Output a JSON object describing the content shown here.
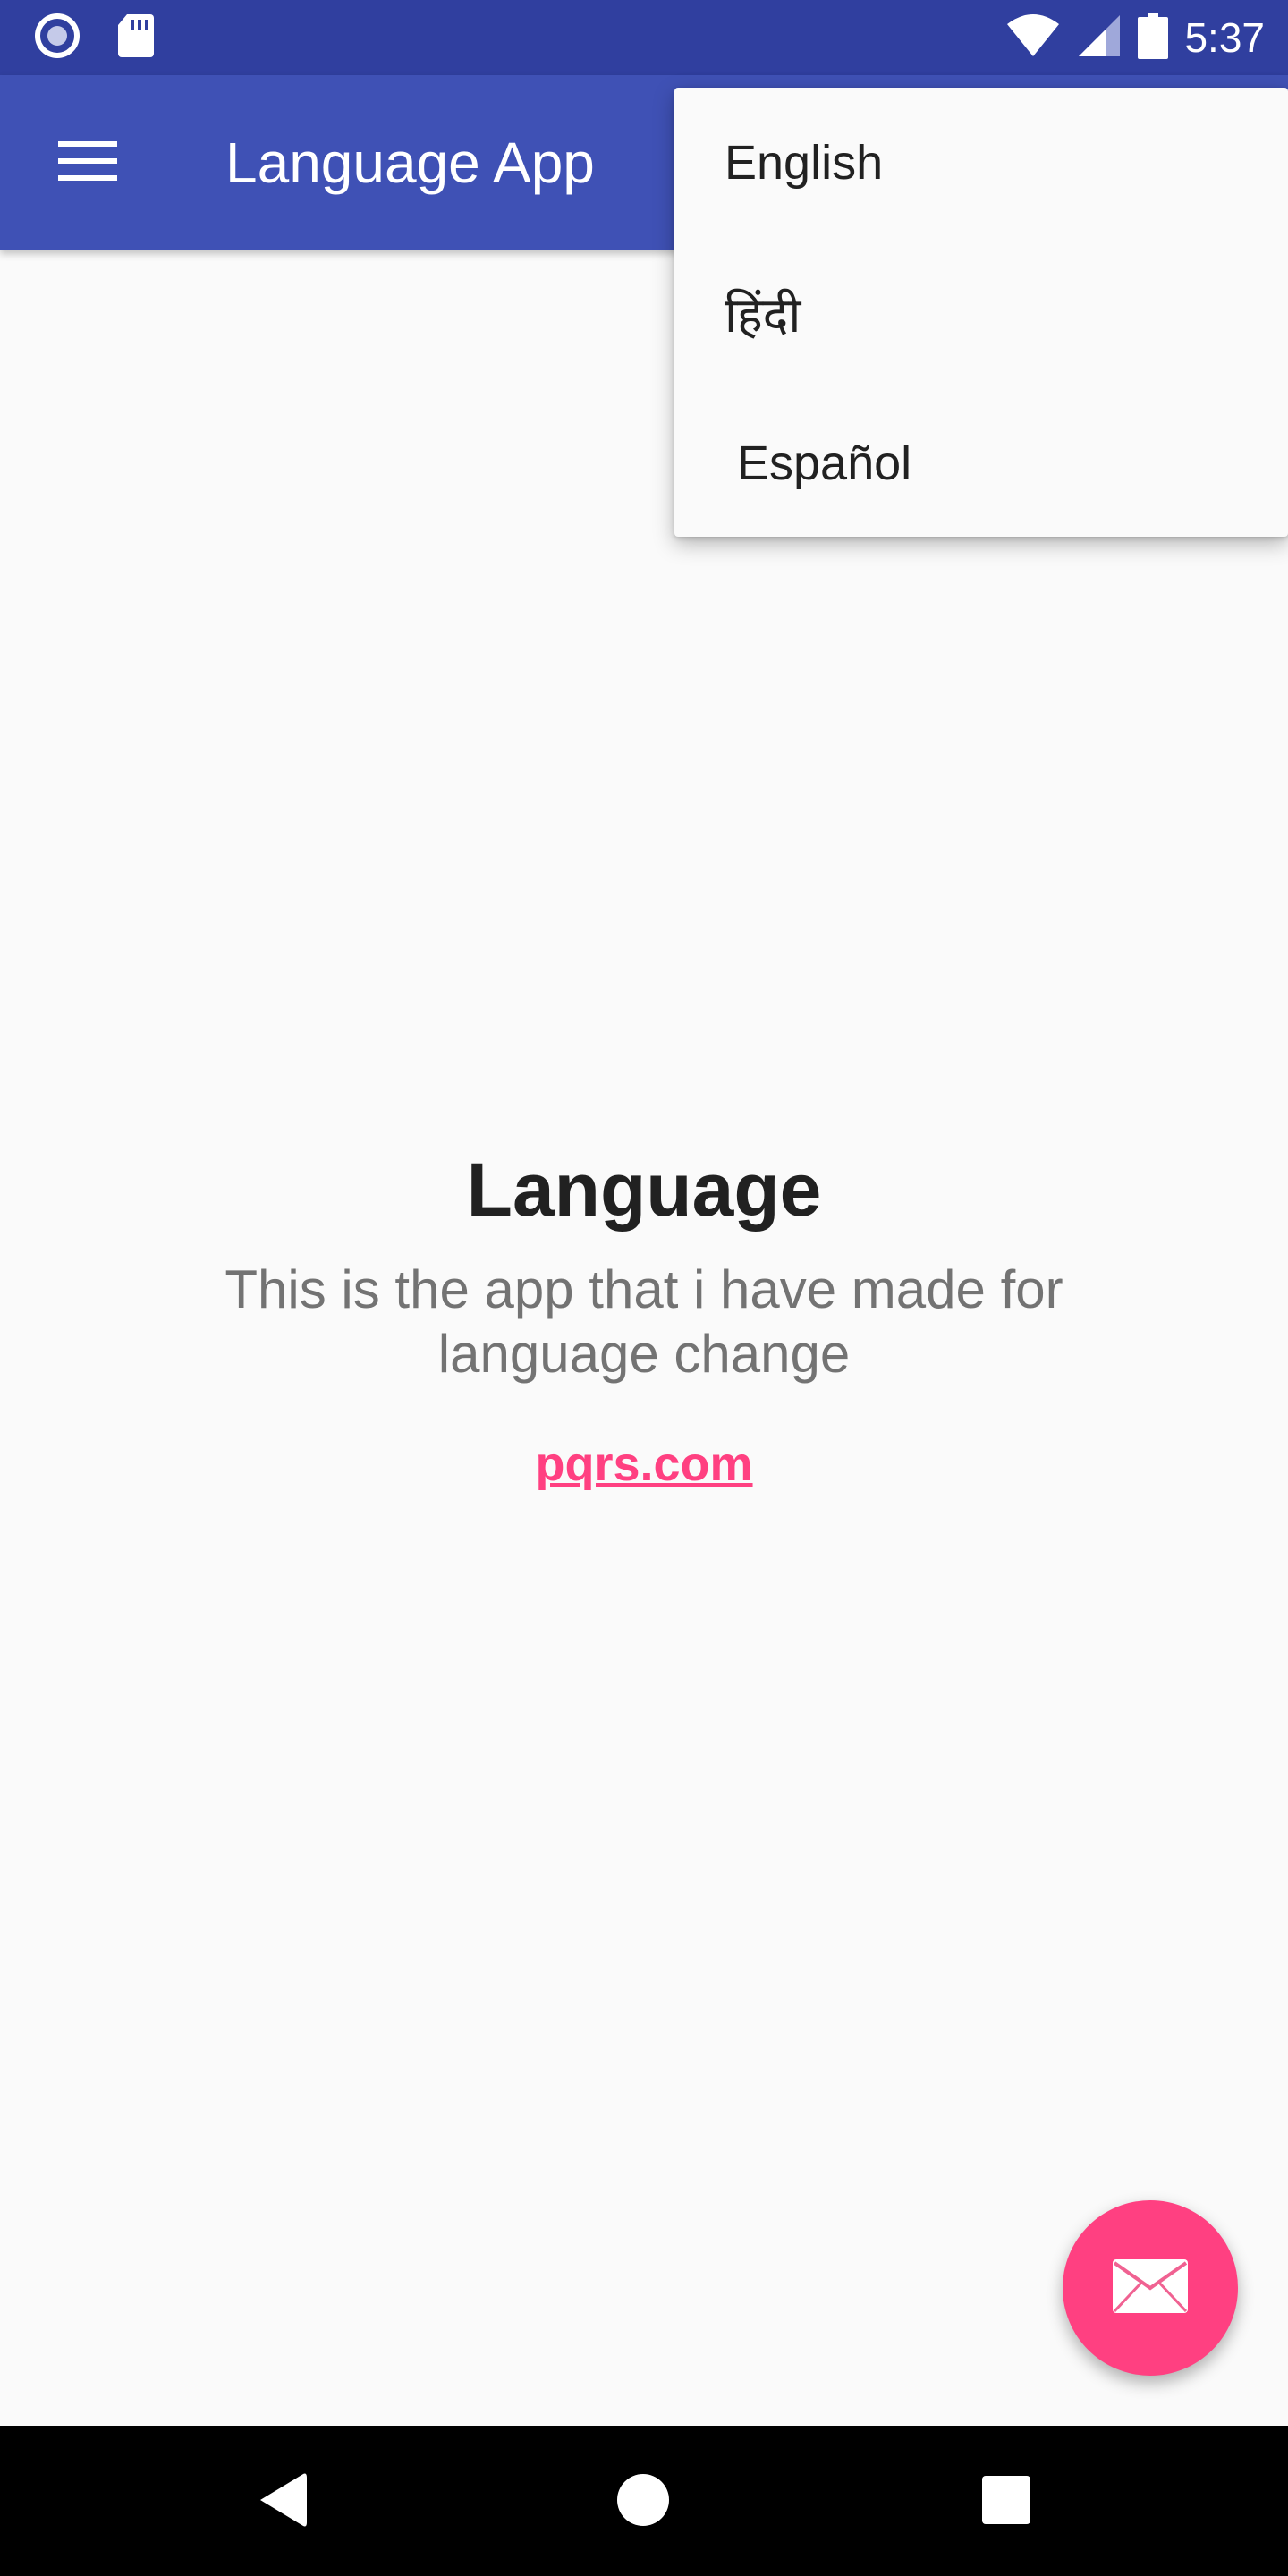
{
  "status_bar": {
    "time": "5:37",
    "icons": [
      "circle-record-icon",
      "sd-card-icon",
      "wifi-icon",
      "cell-signal-icon",
      "battery-icon"
    ],
    "background": "#303f9f"
  },
  "app_bar": {
    "title": "Language App",
    "menu_icon": "menu-icon",
    "background": "#3f51b5"
  },
  "language_menu": {
    "items": [
      {
        "label": "English"
      },
      {
        "label": "हिंदी"
      },
      {
        "label": "Español"
      }
    ]
  },
  "main": {
    "headline": "Language",
    "description": "This is the app that i have made for language change",
    "link": "pqrs.com",
    "link_color": "#ff4081"
  },
  "fab": {
    "icon": "email-icon",
    "color": "#ff4081"
  },
  "nav_bar": {
    "icons": [
      "back-icon",
      "home-icon",
      "recents-icon"
    ]
  }
}
